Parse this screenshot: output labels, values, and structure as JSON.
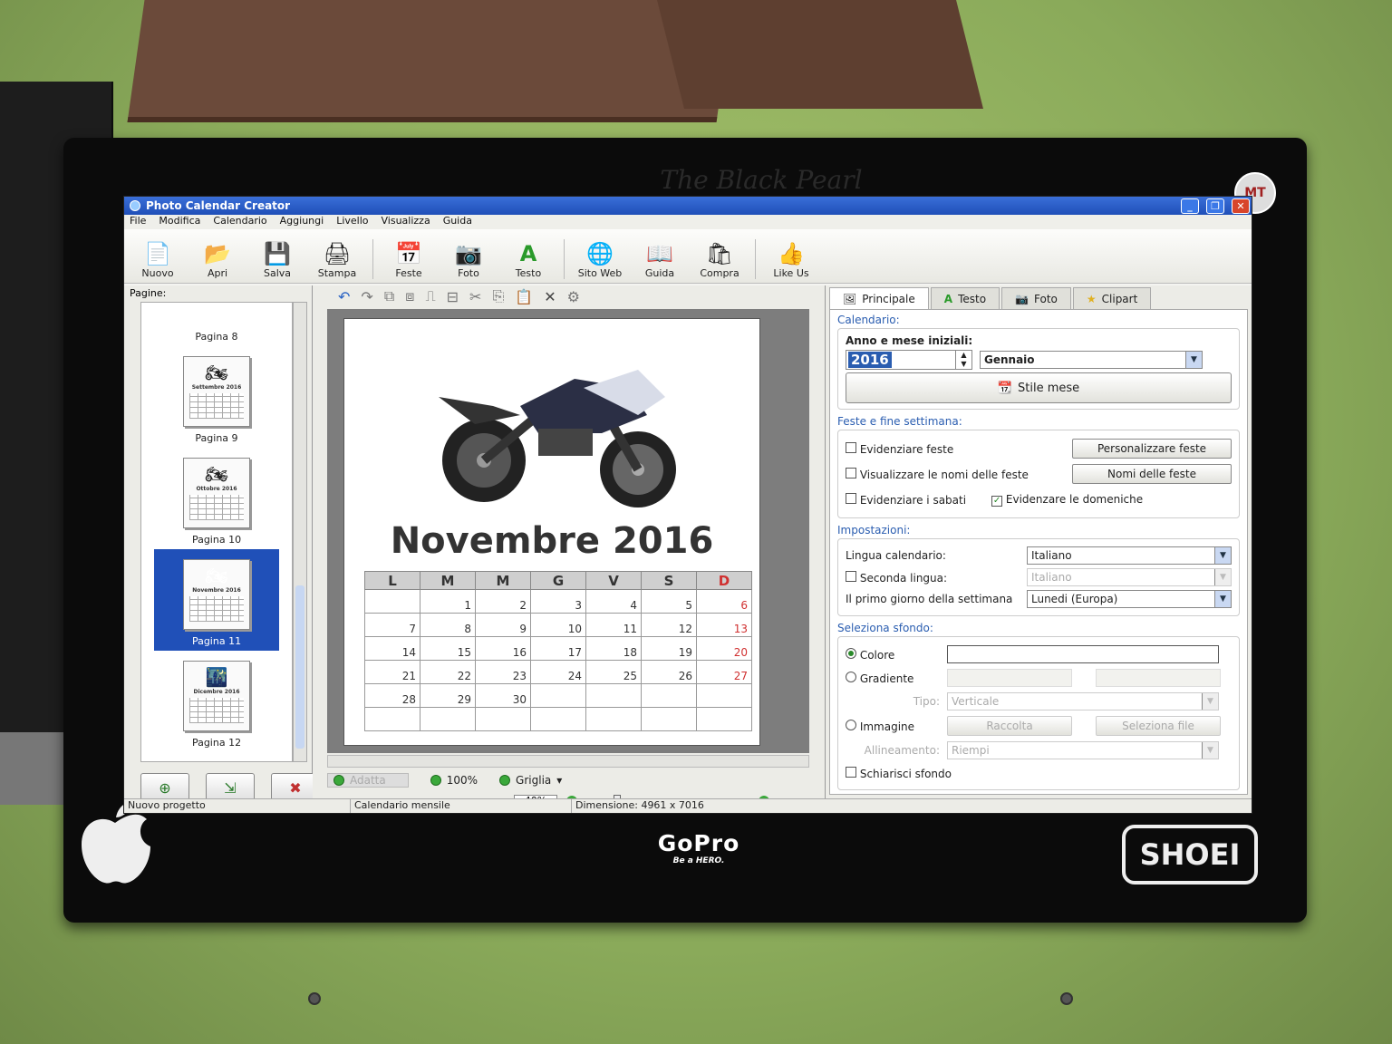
{
  "window": {
    "title": "Photo Calendar Creator"
  },
  "menu": [
    "File",
    "Modifica",
    "Calendario",
    "Aggiungi",
    "Livello",
    "Visualizza",
    "Guida"
  ],
  "toolbar": {
    "nuovo": "Nuovo",
    "apri": "Apri",
    "salva": "Salva",
    "stampa": "Stampa",
    "feste": "Feste",
    "foto": "Foto",
    "testo": "Testo",
    "sito_web": "Sito Web",
    "guida": "Guida",
    "compra": "Compra",
    "like_us": "Like Us"
  },
  "pages": {
    "label": "Pagine:",
    "items": [
      {
        "label": "Pagina 8",
        "month": ""
      },
      {
        "label": "Pagina 9",
        "month": "Settembre 2016"
      },
      {
        "label": "Pagina 10",
        "month": "Ottobre 2016"
      },
      {
        "label": "Pagina 11",
        "month": "Novembre 2016"
      },
      {
        "label": "Pagina 12",
        "month": "Dicembre 2016"
      }
    ]
  },
  "calendar": {
    "title": "Novembre 2016",
    "weekdays": [
      "L",
      "M",
      "M",
      "G",
      "V",
      "S",
      "D"
    ],
    "rows": [
      [
        "",
        "1",
        "2",
        "3",
        "4",
        "5",
        "6"
      ],
      [
        "7",
        "8",
        "9",
        "10",
        "11",
        "12",
        "13"
      ],
      [
        "14",
        "15",
        "16",
        "17",
        "18",
        "19",
        "20"
      ],
      [
        "21",
        "22",
        "23",
        "24",
        "25",
        "26",
        "27"
      ],
      [
        "28",
        "29",
        "30",
        "",
        "",
        "",
        ""
      ],
      [
        "",
        "",
        "",
        "",
        "",
        "",
        ""
      ]
    ]
  },
  "zoom": {
    "adatta": "Adatta",
    "percent100": "100%",
    "griglia": "Griglia",
    "level": "40%"
  },
  "tabs": [
    "Principale",
    "Testo",
    "Foto",
    "Clipart"
  ],
  "props": {
    "calendario_title": "Calendario:",
    "anno_mese_label": "Anno e mese iniziali:",
    "year": "2016",
    "month": "Gennaio",
    "stile_mese": "Stile mese",
    "feste_title": "Feste e fine settimana:",
    "evidenziare_feste": "Evidenziare feste",
    "personalizzare_feste": "Personalizzare feste",
    "visualizzare_nomi": "Visualizzare le nomi delle feste",
    "nomi_feste": "Nomi delle feste",
    "evidenziare_sabati": "Evidenziare i sabati",
    "evidenziare_domeniche": "Evidenzare le domeniche",
    "impostazioni_title": "Impostazioni:",
    "lingua_label": "Lingua calendario:",
    "lingua_value": "Italiano",
    "seconda_lingua_label": "Seconda lingua:",
    "seconda_lingua_value": "Italiano",
    "primo_giorno_label": "Il primo giorno della settimana",
    "primo_giorno_value": "Lunedi (Europa)",
    "sfondo_title": "Seleziona sfondo:",
    "colore": "Colore",
    "gradiente": "Gradiente",
    "tipo_label": "Tipo:",
    "tipo_value": "Verticale",
    "immagine": "Immagine",
    "raccolta": "Raccolta",
    "seleziona_file": "Seleziona file",
    "allineamento_label": "Allineamento:",
    "allineamento_value": "Riempi",
    "schiarisci": "Schiarisci sfondo"
  },
  "status": {
    "project": "Nuovo progetto",
    "type": "Calendario mensile",
    "dimension": "Dimensione: 4961 x 7016"
  },
  "monitor": {
    "gopro": "GoPro",
    "gopro_tag": "Be a HERO.",
    "shoei": "SHOEI",
    "sticker": "MT",
    "bezel_text": "The Black Pearl"
  },
  "colors": {
    "accent": "#2050b8",
    "sunday": "#d03030",
    "wall": "#8aaa5a"
  }
}
